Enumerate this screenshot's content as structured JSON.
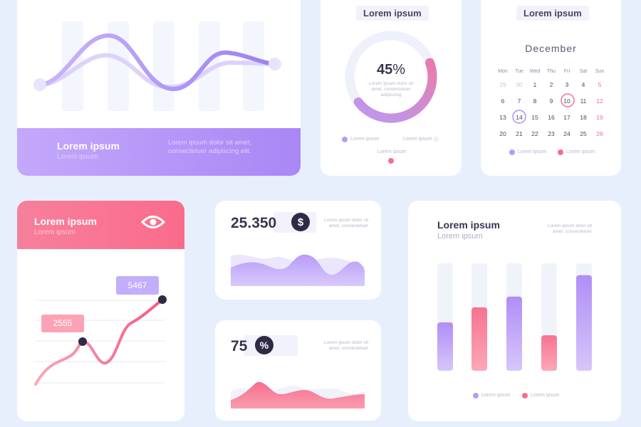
{
  "colors": {
    "background": "#e6effb",
    "purple": "#a98cf4",
    "pink": "#f86d8f",
    "dark": "#2f2a45"
  },
  "card1": {
    "title": "Lorem ipsum",
    "subtitle": "Lorem ipsum",
    "body": "Lorem ipsum dolor sit amet, consectetuer adipiscing elit."
  },
  "donut": {
    "title": "Lorem ipsum",
    "value": "45",
    "unit": "%",
    "fraction": 0.45,
    "description": "Lorem ipsum dolor sit amet, consectetuer adipiscing",
    "legend": [
      "Lorem ipsum",
      "Lorem ipsum",
      "Lorem ipsum"
    ]
  },
  "calendar": {
    "title": "Lorem ipsum",
    "month": "December",
    "weekdays": [
      "Mon",
      "Tue",
      "Wed",
      "Thu",
      "Fri",
      "Sat",
      "Sun"
    ],
    "rows": [
      [
        "29",
        "30",
        "1",
        "2",
        "3",
        "4",
        "5"
      ],
      [
        "6",
        "7",
        "8",
        "9",
        "10",
        "11",
        "12"
      ],
      [
        "13",
        "14",
        "15",
        "16",
        "17",
        "18",
        "19"
      ],
      [
        "20",
        "21",
        "22",
        "23",
        "24",
        "25",
        "26"
      ]
    ],
    "highlight_purple": "14",
    "highlight_pink": "10",
    "legend": [
      "Lorem ipsum",
      "Lorem ipsum"
    ]
  },
  "line_card": {
    "title": "Lorem ipsum",
    "subtitle": "Lorem ipsum",
    "eye_icon": "eye-icon",
    "label_high": "5467",
    "label_low": "2555"
  },
  "stat1": {
    "value": "25.350",
    "icon_symbol": "$",
    "description": "Lorem ipsum dolor sit amet, consectetuer"
  },
  "stat2": {
    "value": "75",
    "icon_symbol": "%",
    "description": "Lorem ipsum dolor sit amet, consectetuer"
  },
  "bar_card": {
    "title": "Lorem ipsum",
    "subtitle": "Lorem ipsum",
    "description": "Lorem ipsum dolor sit amet, consectetuer",
    "legend": [
      "Lorem ipsum",
      "Lorem ipsum"
    ]
  },
  "chart_data": {
    "type": "bar",
    "title": "Lorem ipsum",
    "values": [
      0.45,
      0.59,
      0.69,
      0.33,
      0.89
    ],
    "colors": [
      "purple",
      "pink",
      "purple",
      "pink",
      "purple"
    ],
    "ylim": [
      0,
      1
    ],
    "legend": [
      "Lorem ipsum",
      "Lorem ipsum"
    ]
  }
}
